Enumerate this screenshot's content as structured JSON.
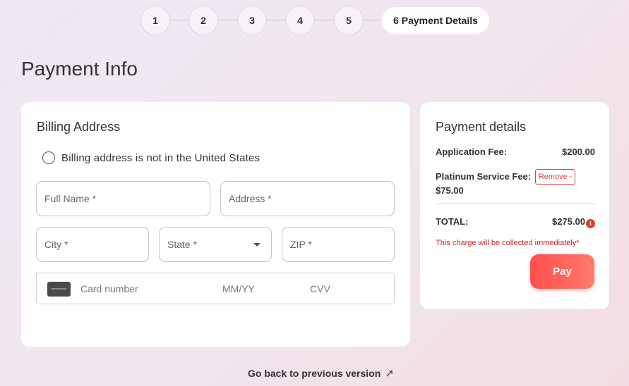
{
  "stepper": {
    "steps": [
      "1",
      "2",
      "3",
      "4",
      "5"
    ],
    "active_label": "6 Payment Details"
  },
  "page_title": "Payment Info",
  "billing": {
    "title": "Billing Address",
    "non_us_label": "Billing address is not in the United States",
    "fields": {
      "full_name_placeholder": "Full Name *",
      "address_placeholder": "Address *",
      "city_placeholder": "City *",
      "state_placeholder": "State *",
      "zip_placeholder": "ZIP *"
    },
    "card": {
      "number_placeholder": "Card number",
      "expiry_placeholder": "MM/YY",
      "cvv_placeholder": "CVV"
    }
  },
  "summary": {
    "title": "Payment details",
    "application_fee_label": "Application Fee:",
    "application_fee_amount": "$200.00",
    "platinum_fee_label": "Platinum Service Fee:",
    "remove_label": "Remove -",
    "platinum_fee_amount": "$75.00",
    "total_label": "TOTAL:",
    "total_amount": "$275.00",
    "info_icon": "i",
    "note": "This charge will be collected immediately*",
    "pay_label": "Pay"
  },
  "footer": {
    "back_link": "Go back to previous version",
    "arrow_icon": "↗"
  },
  "colors": {
    "accent": "#ff5a52",
    "error": "#d42020",
    "card_bg": "#ffffff"
  }
}
